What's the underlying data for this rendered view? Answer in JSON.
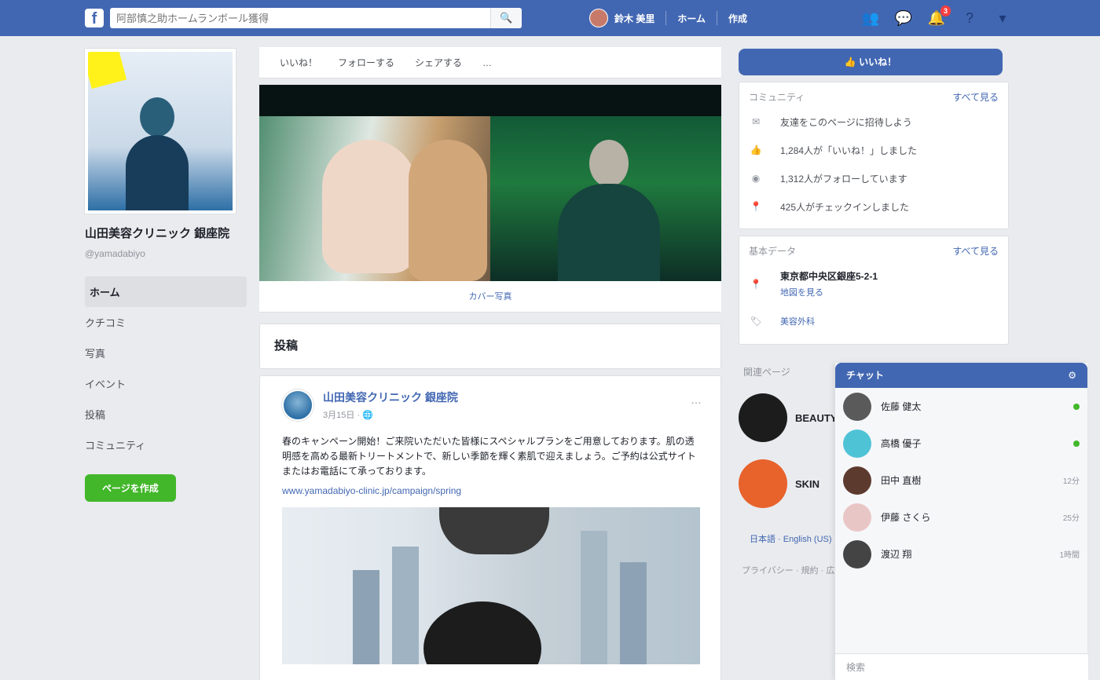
{
  "topbar": {
    "logo": "f",
    "search_placeholder": "阿部慎之助ホームランボール獲得",
    "search_icon": "🔍",
    "profile_name": "鈴木 美里",
    "home_label": "ホーム",
    "create_label": "作成",
    "icons": [
      "friends-icon",
      "messenger-icon",
      "notifications-icon",
      "help-icon",
      "menu-icon"
    ],
    "notification_count": "3"
  },
  "left": {
    "page_name": "山田美容クリニック 銀座院",
    "page_handle": "@yamadabiyo",
    "nav": [
      "ホーム",
      "クチコミ",
      "写真",
      "イベント",
      "投稿",
      "コミュニティ"
    ],
    "create_page_button": "ページを作成"
  },
  "middle": {
    "tabs": [
      "いいね！",
      "フォローする",
      "シェアする",
      "…"
    ],
    "cover_caption": "カバー写真",
    "feed_title": "投稿",
    "post": {
      "author": "山田美容クリニック 銀座院",
      "time": "3月15日 · 🌐",
      "menu": "…",
      "text": "春のキャンペーン開始！ご来院いただいた皆様にスペシャルプランをご用意しております。肌の透明感を高める最新トリートメントで、新しい季節を輝く素肌で迎えましょう。ご予約は公式サイトまたはお電話にて承っております。",
      "link": "www.yamadabiyo-clinic.jp/campaign/spring"
    }
  },
  "right": {
    "like_button": "👍 いいね！",
    "community": {
      "title": "コミュニティ",
      "see_all": "すべて見る",
      "rows": [
        {
          "icon": "invite-icon",
          "text": "友達をこのページに招待しよう"
        },
        {
          "icon": "like-icon",
          "text": "1,284人が「いいね！」しました"
        },
        {
          "icon": "follow-icon",
          "text": "1,312人がフォローしています"
        },
        {
          "icon": "checkin-icon",
          "text": "425人がチェックインしました"
        }
      ]
    },
    "info": {
      "title": "基本データ",
      "see_all": "すべて見る",
      "address": "東京都中央区銀座5-2-1",
      "map_link": "地図を見る",
      "category": "美容外科"
    },
    "suggest_title": "関連ページ",
    "suggestions": [
      {
        "name": "BEAUTY",
        "color": "#1c1c1c"
      },
      {
        "name": "SKIN",
        "color": "#e8622c"
      }
    ],
    "footer_link": "日本語 · English (US)",
    "footer_text": "プライバシー · 規約 · 広告 · Cookie"
  },
  "chat": {
    "title": "チャット",
    "settings": "⚙",
    "contacts": [
      {
        "name": "佐藤 健太",
        "status": "",
        "online": true,
        "color": "#5a5a5a"
      },
      {
        "name": "高橋 優子",
        "status": "",
        "online": true,
        "color": "#4fc3d6"
      },
      {
        "name": "田中 直樹",
        "status": "12分",
        "online": false,
        "color": "#5d3a2e"
      },
      {
        "name": "伊藤 さくら",
        "status": "25分",
        "online": false,
        "color": "#e9c6c6"
      },
      {
        "name": "渡辺 翔",
        "status": "1時間",
        "online": false,
        "color": "#444"
      }
    ],
    "search_placeholder": "検索"
  }
}
